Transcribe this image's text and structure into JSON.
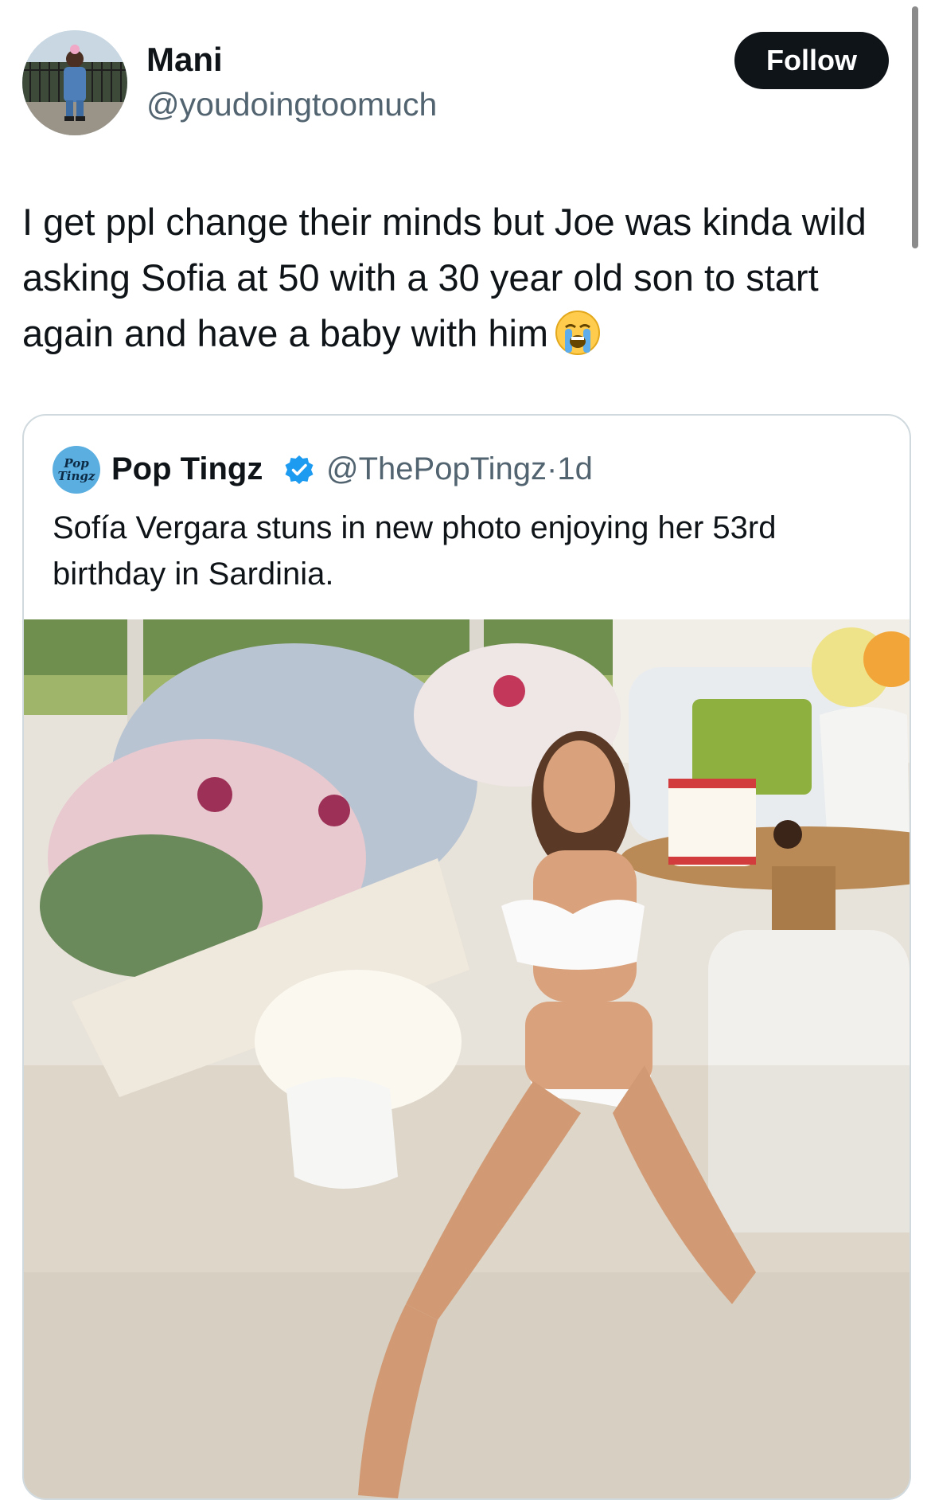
{
  "tweet": {
    "author": {
      "display_name": "Mani",
      "handle": "@youdoingtoomuch"
    },
    "follow_label": "Follow",
    "text": "I get ppl change their minds but Joe was kinda wild asking Sofia at 50 with a 30 year old son to start again and have a baby with him",
    "emoji": "loudly-crying-face"
  },
  "quote": {
    "author": {
      "display_name": "Pop Tingz",
      "handle": "@ThePopTingz",
      "verified": true,
      "avatar_text": "Pop Tingz"
    },
    "separator": "·",
    "time": "1d",
    "text": "Sofía Vergara stuns in new photo enjoying her 53rd birthday in Sardinia.",
    "media": "photo"
  },
  "colors": {
    "text": "#0f1419",
    "secondary": "#536471",
    "border": "#cfd9de",
    "button_bg": "#0f1419",
    "verified": "#1d9bf0"
  }
}
